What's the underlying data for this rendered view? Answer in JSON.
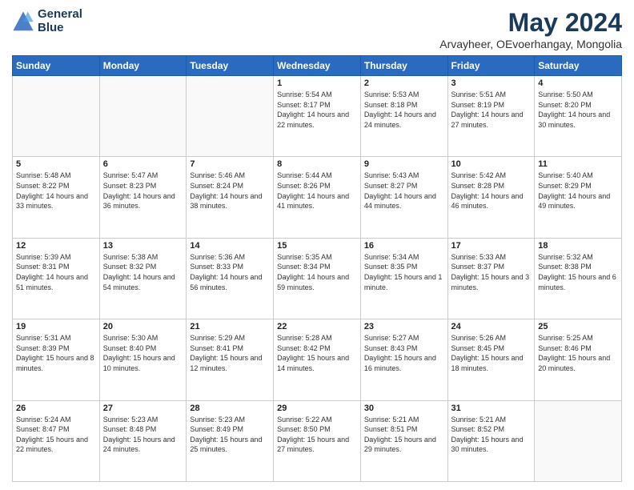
{
  "logo": {
    "line1": "General",
    "line2": "Blue"
  },
  "title": "May 2024",
  "subtitle": "Arvayheer, OEvoerhangay, Mongolia",
  "days_of_week": [
    "Sunday",
    "Monday",
    "Tuesday",
    "Wednesday",
    "Thursday",
    "Friday",
    "Saturday"
  ],
  "weeks": [
    [
      {
        "day": "",
        "info": ""
      },
      {
        "day": "",
        "info": ""
      },
      {
        "day": "",
        "info": ""
      },
      {
        "day": "1",
        "sunrise": "5:54 AM",
        "sunset": "8:17 PM",
        "daylight": "14 hours and 22 minutes."
      },
      {
        "day": "2",
        "sunrise": "5:53 AM",
        "sunset": "8:18 PM",
        "daylight": "14 hours and 24 minutes."
      },
      {
        "day": "3",
        "sunrise": "5:51 AM",
        "sunset": "8:19 PM",
        "daylight": "14 hours and 27 minutes."
      },
      {
        "day": "4",
        "sunrise": "5:50 AM",
        "sunset": "8:20 PM",
        "daylight": "14 hours and 30 minutes."
      }
    ],
    [
      {
        "day": "5",
        "sunrise": "5:48 AM",
        "sunset": "8:22 PM",
        "daylight": "14 hours and 33 minutes."
      },
      {
        "day": "6",
        "sunrise": "5:47 AM",
        "sunset": "8:23 PM",
        "daylight": "14 hours and 36 minutes."
      },
      {
        "day": "7",
        "sunrise": "5:46 AM",
        "sunset": "8:24 PM",
        "daylight": "14 hours and 38 minutes."
      },
      {
        "day": "8",
        "sunrise": "5:44 AM",
        "sunset": "8:26 PM",
        "daylight": "14 hours and 41 minutes."
      },
      {
        "day": "9",
        "sunrise": "5:43 AM",
        "sunset": "8:27 PM",
        "daylight": "14 hours and 44 minutes."
      },
      {
        "day": "10",
        "sunrise": "5:42 AM",
        "sunset": "8:28 PM",
        "daylight": "14 hours and 46 minutes."
      },
      {
        "day": "11",
        "sunrise": "5:40 AM",
        "sunset": "8:29 PM",
        "daylight": "14 hours and 49 minutes."
      }
    ],
    [
      {
        "day": "12",
        "sunrise": "5:39 AM",
        "sunset": "8:31 PM",
        "daylight": "14 hours and 51 minutes."
      },
      {
        "day": "13",
        "sunrise": "5:38 AM",
        "sunset": "8:32 PM",
        "daylight": "14 hours and 54 minutes."
      },
      {
        "day": "14",
        "sunrise": "5:36 AM",
        "sunset": "8:33 PM",
        "daylight": "14 hours and 56 minutes."
      },
      {
        "day": "15",
        "sunrise": "5:35 AM",
        "sunset": "8:34 PM",
        "daylight": "14 hours and 59 minutes."
      },
      {
        "day": "16",
        "sunrise": "5:34 AM",
        "sunset": "8:35 PM",
        "daylight": "15 hours and 1 minute."
      },
      {
        "day": "17",
        "sunrise": "5:33 AM",
        "sunset": "8:37 PM",
        "daylight": "15 hours and 3 minutes."
      },
      {
        "day": "18",
        "sunrise": "5:32 AM",
        "sunset": "8:38 PM",
        "daylight": "15 hours and 6 minutes."
      }
    ],
    [
      {
        "day": "19",
        "sunrise": "5:31 AM",
        "sunset": "8:39 PM",
        "daylight": "15 hours and 8 minutes."
      },
      {
        "day": "20",
        "sunrise": "5:30 AM",
        "sunset": "8:40 PM",
        "daylight": "15 hours and 10 minutes."
      },
      {
        "day": "21",
        "sunrise": "5:29 AM",
        "sunset": "8:41 PM",
        "daylight": "15 hours and 12 minutes."
      },
      {
        "day": "22",
        "sunrise": "5:28 AM",
        "sunset": "8:42 PM",
        "daylight": "15 hours and 14 minutes."
      },
      {
        "day": "23",
        "sunrise": "5:27 AM",
        "sunset": "8:43 PM",
        "daylight": "15 hours and 16 minutes."
      },
      {
        "day": "24",
        "sunrise": "5:26 AM",
        "sunset": "8:45 PM",
        "daylight": "15 hours and 18 minutes."
      },
      {
        "day": "25",
        "sunrise": "5:25 AM",
        "sunset": "8:46 PM",
        "daylight": "15 hours and 20 minutes."
      }
    ],
    [
      {
        "day": "26",
        "sunrise": "5:24 AM",
        "sunset": "8:47 PM",
        "daylight": "15 hours and 22 minutes."
      },
      {
        "day": "27",
        "sunrise": "5:23 AM",
        "sunset": "8:48 PM",
        "daylight": "15 hours and 24 minutes."
      },
      {
        "day": "28",
        "sunrise": "5:23 AM",
        "sunset": "8:49 PM",
        "daylight": "15 hours and 25 minutes."
      },
      {
        "day": "29",
        "sunrise": "5:22 AM",
        "sunset": "8:50 PM",
        "daylight": "15 hours and 27 minutes."
      },
      {
        "day": "30",
        "sunrise": "5:21 AM",
        "sunset": "8:51 PM",
        "daylight": "15 hours and 29 minutes."
      },
      {
        "day": "31",
        "sunrise": "5:21 AM",
        "sunset": "8:52 PM",
        "daylight": "15 hours and 30 minutes."
      },
      {
        "day": "",
        "info": ""
      }
    ]
  ]
}
